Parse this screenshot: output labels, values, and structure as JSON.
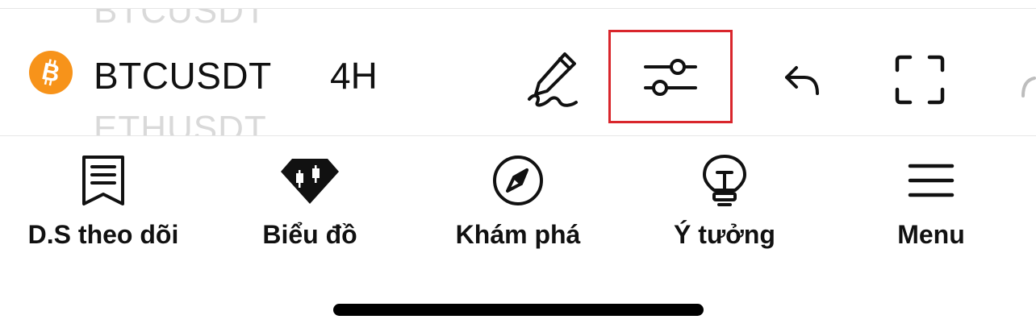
{
  "toolbar": {
    "symbol_prev": "BTCUSDT",
    "symbol": "BTCUSDT",
    "symbol_next": "ETHUSDT",
    "interval": "4H",
    "coin_icon": "bitcoin-icon",
    "tools": [
      {
        "name": "drawing-tools",
        "icon": "pen-signature-icon"
      },
      {
        "name": "chart-settings",
        "icon": "sliders-icon",
        "highlighted": true
      },
      {
        "name": "undo",
        "icon": "undo-arrow-icon"
      },
      {
        "name": "fullscreen",
        "icon": "fullscreen-icon"
      }
    ]
  },
  "nav": {
    "items": [
      {
        "label": "D.S theo dõi",
        "icon": "watchlist-icon"
      },
      {
        "label": "Biểu đồ",
        "icon": "candlestick-chart-icon"
      },
      {
        "label": "Khám phá",
        "icon": "compass-icon"
      },
      {
        "label": "Ý tưởng",
        "icon": "lightbulb-icon"
      },
      {
        "label": "Menu",
        "icon": "hamburger-icon"
      }
    ]
  },
  "colors": {
    "bitcoin": "#f7931a",
    "highlight": "#d9262c",
    "text": "#111111",
    "ghost_text": "#d9d9d9"
  }
}
